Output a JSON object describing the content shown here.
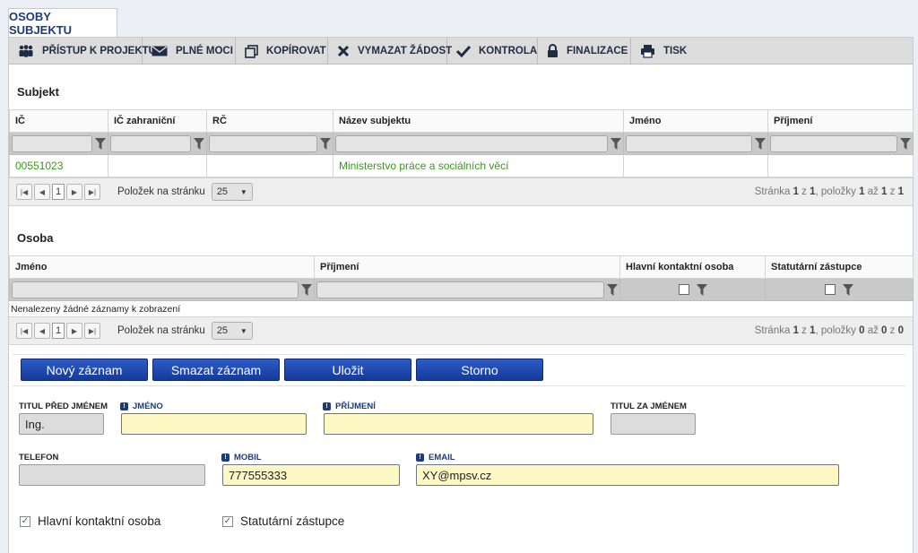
{
  "tab": {
    "label": "OSOBY SUBJEKTU"
  },
  "toolbar": {
    "items": [
      {
        "label": "PŘÍSTUP K PROJEKTU",
        "icon": "people-icon"
      },
      {
        "label": "PLNÉ MOCI",
        "icon": "envelope-icon"
      },
      {
        "label": "KOPÍROVAT",
        "icon": "copy-icon"
      },
      {
        "label": "VYMAZAT ŽÁDOST",
        "icon": "delete-icon"
      },
      {
        "label": "KONTROLA",
        "icon": "checkmark-icon"
      },
      {
        "label": "FINALIZACE",
        "icon": "lock-icon"
      },
      {
        "label": "TISK",
        "icon": "printer-icon"
      }
    ]
  },
  "subjekt": {
    "title": "Subjekt",
    "columns": [
      "IČ",
      "IČ zahraniční",
      "RČ",
      "Název subjektu",
      "Jméno",
      "Příjmení"
    ],
    "rows": [
      [
        "00551023",
        "",
        "",
        "Ministerstvo práce a sociálních věcí",
        "",
        ""
      ]
    ],
    "pager": {
      "page": "1",
      "per_page_label": "Položek na stránku",
      "per_page": "25",
      "info": {
        "a": "Stránka ",
        "page": "1",
        "b": " z ",
        "pages": "1",
        "c": ", položky ",
        "from": "1",
        "d": " až ",
        "to": "1",
        "e": " z ",
        "total": "1"
      }
    }
  },
  "osoba": {
    "title": "Osoba",
    "columns": [
      "Jméno",
      "Příjmení",
      "Hlavní kontaktní osoba",
      "Statutární zástupce"
    ],
    "empty": "Nenalezeny žádné záznamy k zobrazení",
    "pager": {
      "page": "1",
      "per_page_label": "Položek na stránku",
      "per_page": "25",
      "info": {
        "a": "Stránka ",
        "page": "1",
        "b": " z ",
        "pages": "1",
        "c": ", položky ",
        "from": "0",
        "d": " až ",
        "to": "0",
        "e": " z ",
        "total": "0"
      }
    }
  },
  "buttons": {
    "new": "Nový záznam",
    "delete": "Smazat záznam",
    "save": "Uložit",
    "cancel": "Storno"
  },
  "form": {
    "titul_pred": {
      "label": "TITUL PŘED JMÉNEM",
      "value": "Ing."
    },
    "jmeno": {
      "label": "JMÉNO",
      "value": ""
    },
    "prijmeni": {
      "label": "PŘÍJMENÍ",
      "value": ""
    },
    "titul_za": {
      "label": "TITUL ZA JMÉNEM",
      "value": ""
    },
    "telefon": {
      "label": "TELEFON",
      "value": ""
    },
    "mobil": {
      "label": "MOBIL",
      "value": "777555333"
    },
    "email": {
      "label": "EMAIL",
      "value": "XY@mpsv.cz"
    },
    "hlavni": {
      "label": "Hlavní kontaktní osoba",
      "checked": true
    },
    "statutarni": {
      "label": "Statutární zástupce",
      "checked": true
    }
  },
  "colors": {
    "accent": "#1d3a7a",
    "button": "#1a44a8",
    "link_green": "#3a9a1e",
    "required_yellow": "#fdf8c4"
  }
}
